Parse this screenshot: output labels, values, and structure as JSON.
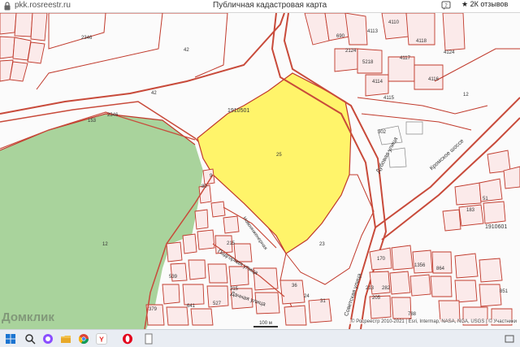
{
  "browser": {
    "address": "pkk.rosreestr.ru",
    "page_title": "Публичная кадастровая карта",
    "reviews_label": "2К отзывов",
    "reviews_count_badge": "2"
  },
  "map": {
    "parcel_labels": {
      "p2346_top": "2346",
      "p42_top": "42",
      "p42_mid": "42",
      "quarter": "1910501",
      "p153": "153",
      "p2346_mid": "2346",
      "p25": "25",
      "p12_left": "12",
      "p23": "23",
      "p302": "302",
      "p12_right": "12",
      "p4110": "4110",
      "p4118": "4118",
      "p4114": "4114",
      "p4116": "4116",
      "p4115": "4115",
      "p4117": "4117",
      "p4113": "4113",
      "p5218": "5218",
      "p2124": "2124",
      "p690": "690",
      "p4124": "4124",
      "p51": "51",
      "p183": "183",
      "p1910601": "1910601",
      "p170": "170",
      "p1356": "1356",
      "p864": "864",
      "p213": "213",
      "p282": "282",
      "p205": "205",
      "p788": "788",
      "p851": "851",
      "p36": "36",
      "p24": "24",
      "p31": "31",
      "p215": "215",
      "p539": "539",
      "p379": "379",
      "p527": "527",
      "p641": "641",
      "p315": "315",
      "p9": "9",
      "p80": "80"
    },
    "streets": {
      "kromskoe": "Кромское шоссе",
      "dubovaya": "Дубовая улица",
      "sovetskaya": "Советская улица",
      "podgornaya": "Подгорная улица",
      "dachnaya": "Дачная улица",
      "novoinzhenernaya": "Новоинженерная"
    },
    "attribution": "© Росреестр 2010-2021 | Esri, Intermap, NASA, NGA, USGS | © Участники",
    "scale_label": "100 м",
    "watermark": "Домклик"
  },
  "colors": {
    "highlight_parcel": "#fff46a",
    "forest": "#a9d39c",
    "boundary": "#c0392b",
    "road": "#c84a3a"
  },
  "taskbar": {
    "icons": [
      "windows-start-icon",
      "search-icon",
      "alice-icon",
      "file-explorer-icon",
      "chrome-icon",
      "yandex-browser-icon",
      "opera-icon",
      "document-icon"
    ]
  }
}
